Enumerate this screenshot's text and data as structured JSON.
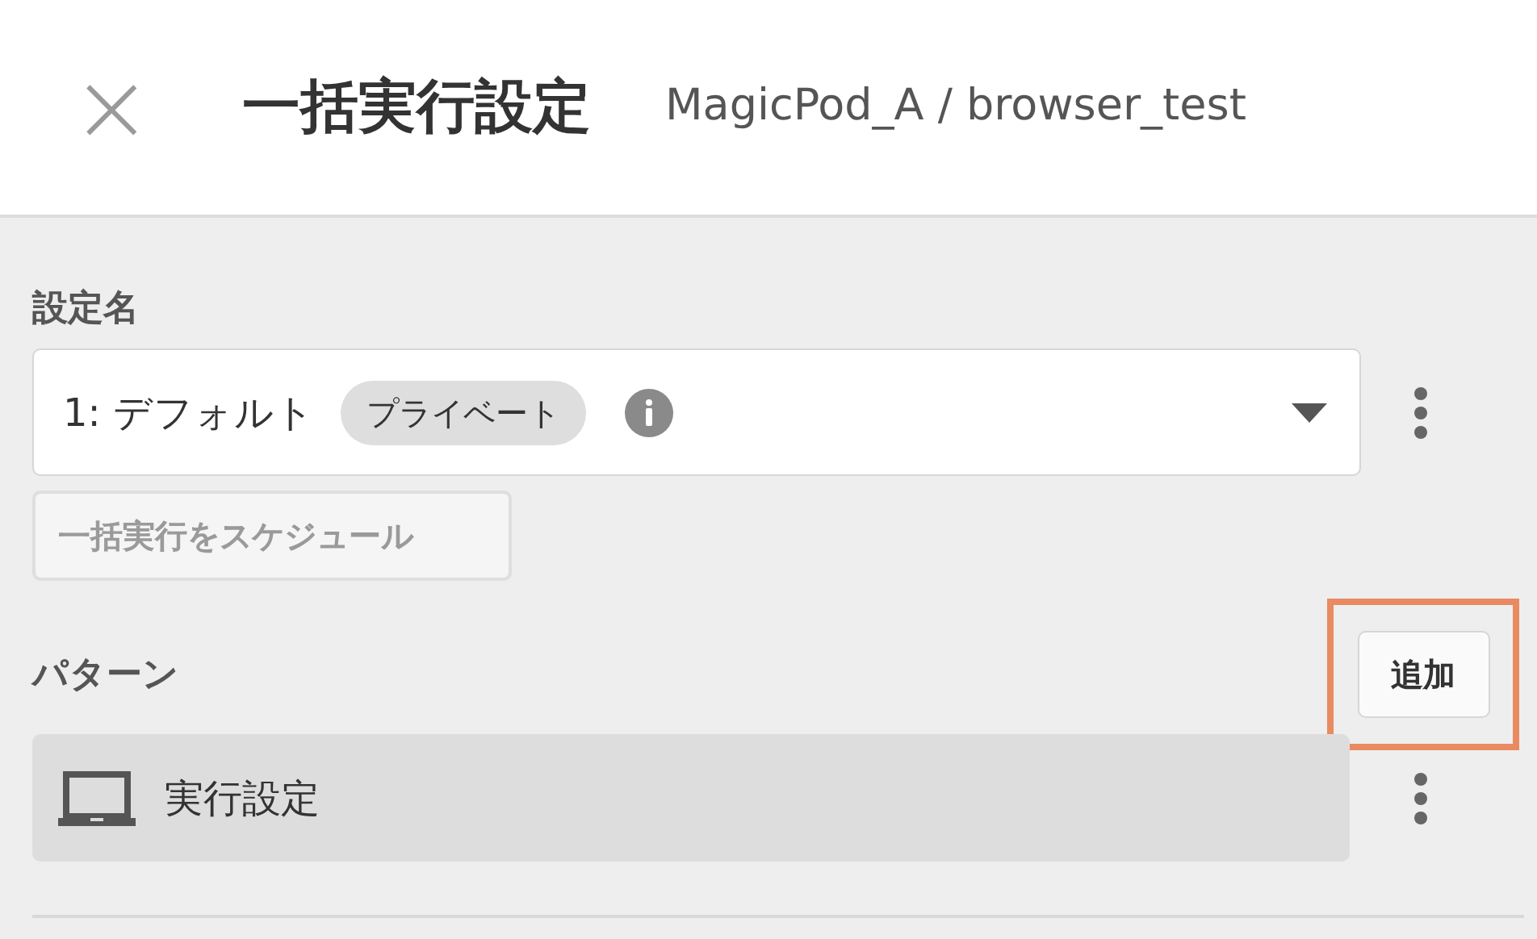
{
  "header": {
    "close_icon": "×",
    "title": "一括実行設定",
    "subtitle": "MagicPod_A / browser_test"
  },
  "setting": {
    "label": "設定名",
    "value": "1: デフォルト",
    "badge": "プライベート"
  },
  "schedule_button": {
    "label": "一括実行をスケジュール",
    "disabled": true
  },
  "patterns": {
    "label": "パターン",
    "add_button": {
      "label": "追加",
      "highlighted": true
    },
    "items": [
      {
        "label": "実行設定"
      }
    ]
  }
}
